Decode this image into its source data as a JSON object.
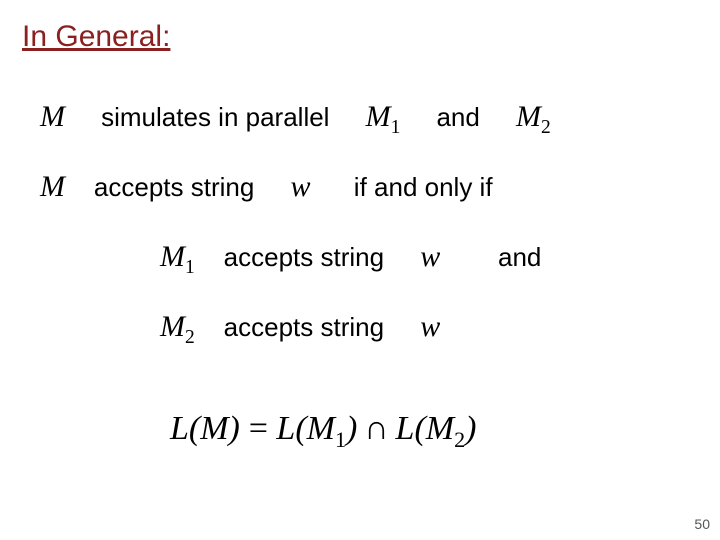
{
  "heading": "In General:",
  "symbols": {
    "M": "M",
    "M1": "M",
    "M2": "M",
    "w": "w",
    "sub1": "1",
    "sub2": "2"
  },
  "text": {
    "simulates": "simulates in parallel",
    "and": "and",
    "accepts_string": "accepts string",
    "iff": "if and only if",
    "eq_left": "L(M) = L(M",
    "eq_mid": ") ∩ L(M",
    "eq_right": ")"
  },
  "page_number": "50"
}
